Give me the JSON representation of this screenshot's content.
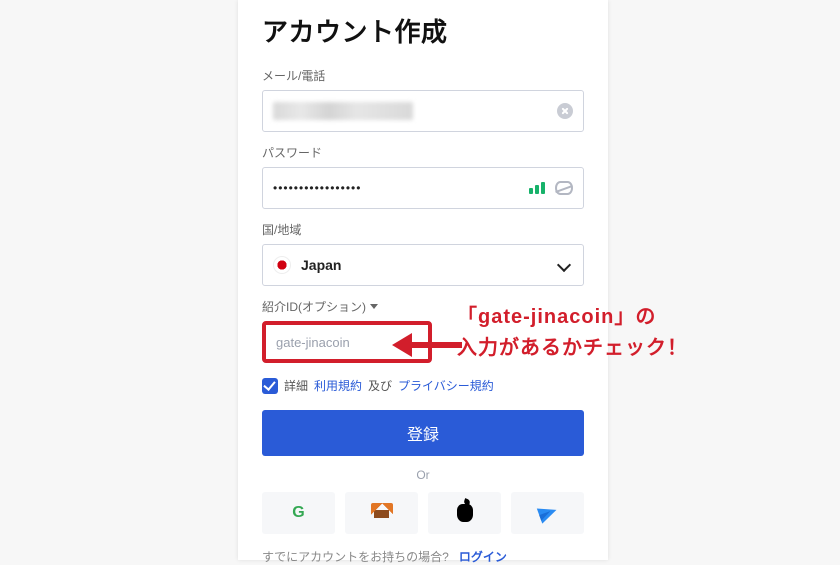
{
  "title": "アカウント作成",
  "email": {
    "label": "メール/電話",
    "value_masked": true
  },
  "password": {
    "label": "パスワード",
    "value": "•••••••••••••••••",
    "strength": "strong"
  },
  "country": {
    "label": "国/地域",
    "selected": "Japan",
    "flag": "jp"
  },
  "referral": {
    "label": "紹介ID(オプション)",
    "placeholder": "gate-jinacoin"
  },
  "terms": {
    "checked": true,
    "prefix": "詳細",
    "tos": "利用規約",
    "mid": "及び",
    "privacy": "プライバシー規約"
  },
  "register_label": "登録",
  "or_label": "Or",
  "social": {
    "google": "google",
    "metamask": "metamask",
    "apple": "apple",
    "telegram": "telegram"
  },
  "login_prompt": {
    "text": "すでにアカウントをお持ちの場合?",
    "link": "ログイン"
  },
  "annotation": {
    "line1": "「gate-jinacoin」の",
    "line2": "入力があるかチェック！"
  }
}
